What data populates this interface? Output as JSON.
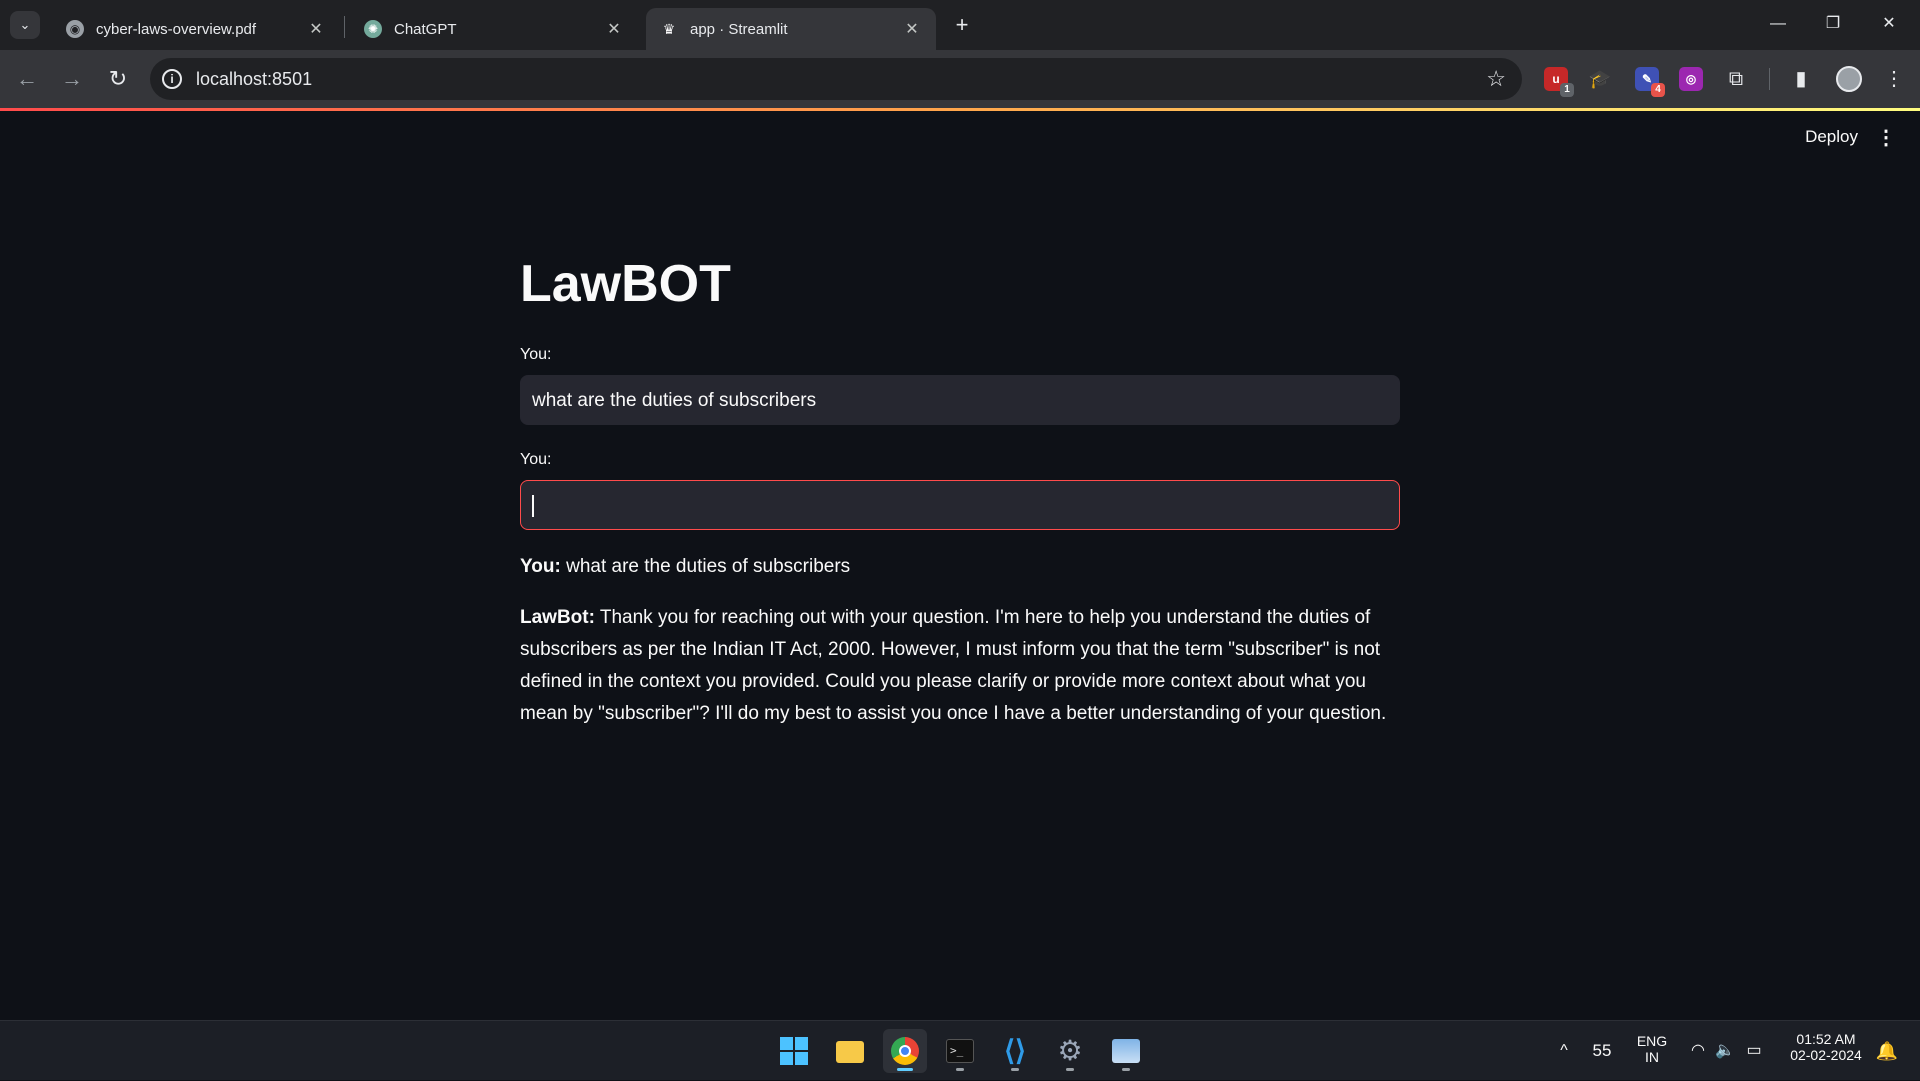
{
  "browser": {
    "tabs": [
      {
        "title": "cyber-laws-overview.pdf",
        "close": "✕"
      },
      {
        "title": "ChatGPT",
        "close": "✕"
      },
      {
        "title": "app · Streamlit",
        "close": "✕"
      }
    ],
    "new_tab": "+",
    "url": "localhost:8501",
    "extensions": [
      {
        "name": "ublock-icon",
        "badge": "1",
        "color": "#c62828",
        "glyph": "u"
      },
      {
        "name": "hat-icon",
        "badge": "",
        "color": "#35363a",
        "glyph": "🎓"
      },
      {
        "name": "extension-blue-icon",
        "badge": "4",
        "color": "#3f51b5",
        "glyph": "✎"
      },
      {
        "name": "extension-purple-icon",
        "badge": "",
        "color": "#9c27b0",
        "glyph": "◎"
      }
    ]
  },
  "app": {
    "deploy_label": "Deploy",
    "title": "LawBOT",
    "input1_label": "You:",
    "input1_value": "what are the duties of subscribers",
    "input2_label": "You:",
    "input2_value": "",
    "you_prefix": "You:",
    "you_message": " what are the duties of subscribers",
    "bot_prefix": "LawBot:",
    "bot_message": " Thank you for reaching out with your question. I'm here to help you understand the duties of subscribers as per the Indian IT Act, 2000. However, I must inform you that the term \"subscriber\" is not defined in the context you provided. Could you please clarify or provide more context about what you mean by \"subscriber\"? I'll do my best to assist you once I have a better understanding of your question."
  },
  "taskbar": {
    "apps": [
      "start",
      "file-explorer",
      "chrome",
      "terminal",
      "vscode",
      "settings",
      "photos"
    ],
    "temperature": "55",
    "language": "ENG",
    "region": "IN",
    "time": "01:52 AM",
    "date": "02-02-2024"
  },
  "colors": {
    "accent": "#ff4b4b",
    "background": "#0e1117",
    "input_bg": "#262730"
  }
}
